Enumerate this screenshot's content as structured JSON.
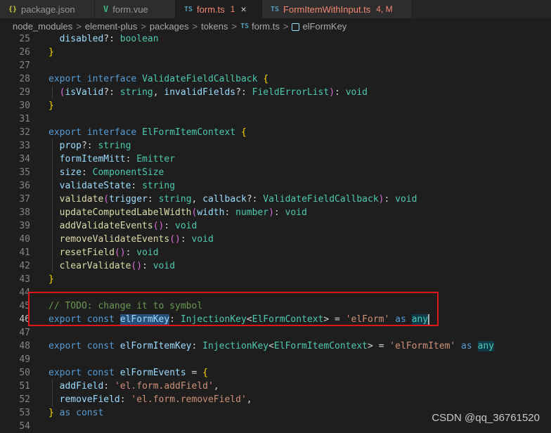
{
  "tabs": [
    {
      "icon": "{}",
      "label": "package.json",
      "badge": ""
    },
    {
      "icon": "V",
      "label": "form.vue",
      "badge": ""
    },
    {
      "icon": "TS",
      "label": "form.ts",
      "badge": "1"
    },
    {
      "icon": "TS",
      "label": "FormItemWithInput.ts",
      "badge": "4, M"
    }
  ],
  "close_glyph": "×",
  "breadcrumb": {
    "items": [
      "node_modules",
      "element-plus",
      "packages",
      "tokens",
      "form.ts",
      "elFormKey"
    ],
    "ts_icon": "TS",
    "separator": ">"
  },
  "editor": {
    "line_numbers": [
      "25",
      "26",
      "27",
      "28",
      "29",
      "30",
      "31",
      "32",
      "33",
      "34",
      "35",
      "36",
      "37",
      "38",
      "39",
      "40",
      "41",
      "42",
      "43",
      "44",
      "45",
      "46",
      "47",
      "48",
      "49",
      "50",
      "51",
      "52",
      "53",
      "54"
    ],
    "current_line": "46",
    "tokens": {
      "disabled": "disabled",
      "boolean": "boolean",
      "export": "export",
      "interface": "interface",
      "const": "const",
      "as": "as",
      "any": "any",
      "string": "string",
      "void": "void",
      "number": "number",
      "ValidateFieldCallback": "ValidateFieldCallback",
      "isValid": "isValid",
      "invalidFields": "invalidFields",
      "FieldErrorList": "FieldErrorList",
      "ElFormItemContext": "ElFormItemContext",
      "prop": "prop",
      "formItemMitt": "formItemMitt",
      "Emitter": "Emitter",
      "size": "size",
      "ComponentSize": "ComponentSize",
      "validateState": "validateState",
      "validate": "validate",
      "trigger": "trigger",
      "callback": "callback",
      "updateComputedLabelWidth": "updateComputedLabelWidth",
      "width": "width",
      "addValidateEvents": "addValidateEvents",
      "removeValidateEvents": "removeValidateEvents",
      "resetField": "resetField",
      "clearValidate": "clearValidate",
      "todo_comment": "// TODO: change it to symbol",
      "elFormKey": "elFormKey",
      "InjectionKey": "InjectionKey",
      "ElFormContext": "ElFormContext",
      "str_elForm": "'elForm'",
      "elFormItemKey": "elFormItemKey",
      "str_elFormItem": "'elFormItem'",
      "elFormEvents": "elFormEvents",
      "addField": "addField",
      "str_addField": "'el.form.addField'",
      "removeField": "removeField",
      "str_removeField": "'el.form.removeField'"
    }
  },
  "watermark": "CSDN @qq_36761520"
}
